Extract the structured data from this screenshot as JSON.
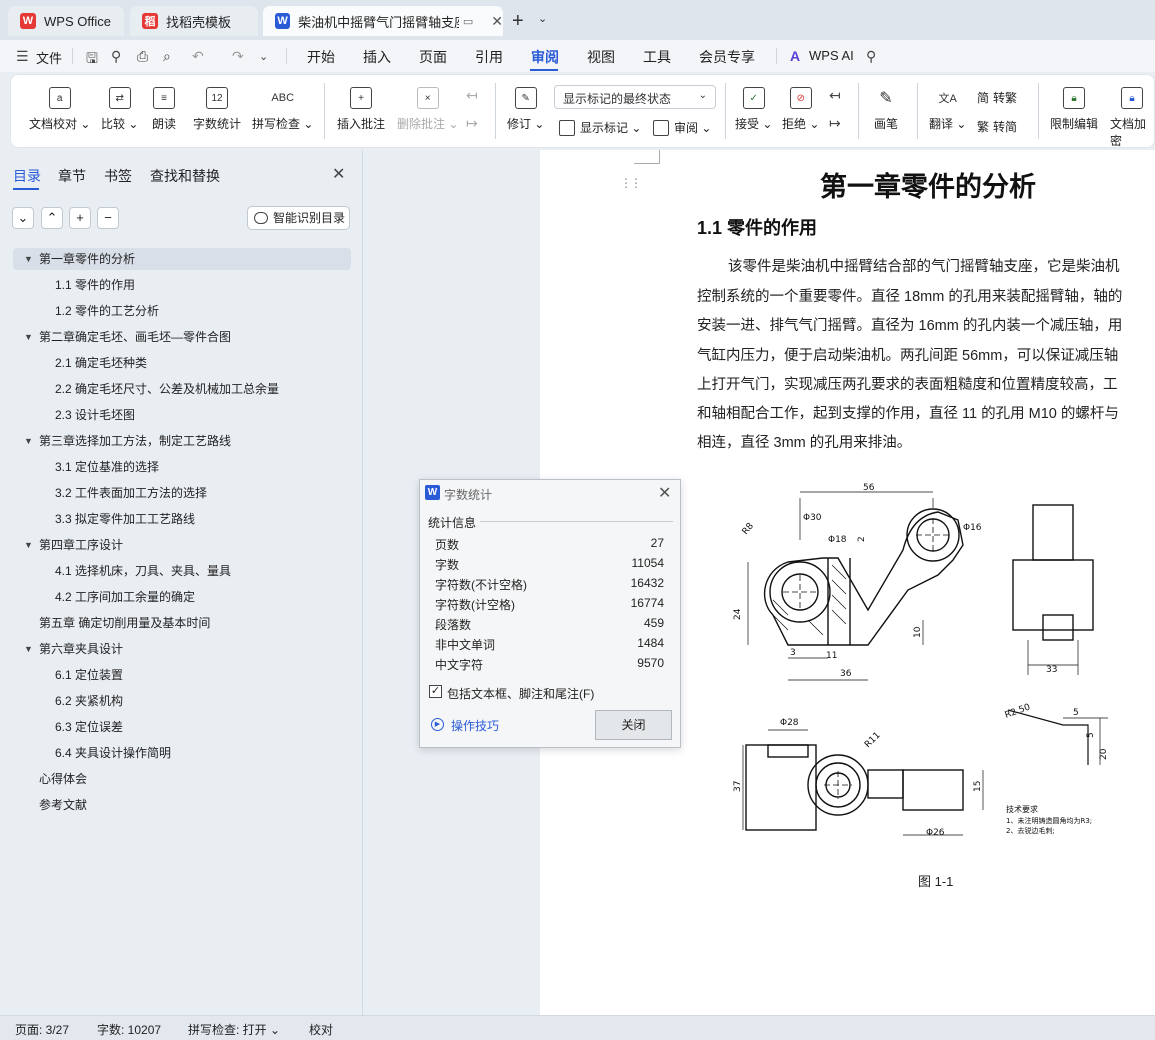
{
  "tabs": [
    {
      "label": "WPS Office"
    },
    {
      "label": "找稻壳模板"
    },
    {
      "label": "柴油机中摇臂气门摇臂轴支座"
    }
  ],
  "menu": {
    "file": "文件",
    "items": [
      "开始",
      "插入",
      "页面",
      "引用",
      "审阅",
      "视图",
      "工具",
      "会员专享"
    ],
    "ai": "WPS AI"
  },
  "ribbon": {
    "doc_proof": "文档校对",
    "compare": "比较",
    "read_aloud": "朗读",
    "word_count": "字数统计",
    "spell_check": "拼写检查",
    "insert_comment": "插入批注",
    "delete_comment": "删除批注",
    "revise": "修订",
    "markup_dropdown": "显示标记的最终状态",
    "show_markup": "显示标记",
    "review": "审阅",
    "accept": "接受",
    "reject": "拒绝",
    "pen": "画笔",
    "translate": "翻译",
    "to_traditional": "转繁",
    "to_simplified": "转简",
    "restrict_edit": "限制编辑",
    "doc_encrypt": "文档加密",
    "word_count_icon_text": "12",
    "spell_icon_text": "ABC"
  },
  "leftpane": {
    "tabs": [
      "目录",
      "章节",
      "书签",
      "查找和替换"
    ],
    "smart_toc": "智能识别目录",
    "toc": [
      {
        "label": "第一章零件的分析",
        "level": 1,
        "expanded": true,
        "selected": true
      },
      {
        "label": "1.1 零件的作用",
        "level": 2
      },
      {
        "label": "1.2 零件的工艺分析",
        "level": 2
      },
      {
        "label": "第二章确定毛坯、画毛坯—零件合图",
        "level": 1,
        "expanded": true
      },
      {
        "label": "2.1 确定毛坯种类",
        "level": 2
      },
      {
        "label": "2.2 确定毛坯尺寸、公差及机械加工总余量",
        "level": 2
      },
      {
        "label": "2.3 设计毛坯图",
        "level": 2
      },
      {
        "label": "第三章选择加工方法，制定工艺路线",
        "level": 1,
        "expanded": true
      },
      {
        "label": "3.1 定位基准的选择",
        "level": 2
      },
      {
        "label": "3.2 工件表面加工方法的选择",
        "level": 2
      },
      {
        "label": "3.3 拟定零件加工工艺路线",
        "level": 2
      },
      {
        "label": "第四章工序设计",
        "level": 1,
        "expanded": true
      },
      {
        "label": "4.1 选择机床，刀具、夹具、量具",
        "level": 2
      },
      {
        "label": "4.2 工序间加工余量的确定",
        "level": 2
      },
      {
        "label": "第五章   确定切削用量及基本时间",
        "level": 1
      },
      {
        "label": "第六章夹具设计",
        "level": 1,
        "expanded": true
      },
      {
        "label": "6.1 定位装置",
        "level": 2
      },
      {
        "label": "6.2 夹紧机构",
        "level": 2
      },
      {
        "label": "6.3 定位误差",
        "level": 2
      },
      {
        "label": "6.4 夹具设计操作简明",
        "level": 2
      },
      {
        "label": "心得体会",
        "level": 1
      },
      {
        "label": "参考文献",
        "level": 1
      }
    ]
  },
  "document": {
    "heading": "第一章零件的分析",
    "subheading": "1.1 零件的作用",
    "lines": [
      "该零件是柴油机中摇臂结合部的气门摇臂轴支座，它是柴油机",
      "控制系统的一个重要零件。直径 18mm 的孔用来装配摇臂轴，轴的",
      "安装一进、排气气门摇臂。直径为 16mm 的孔内装一个减压轴，用",
      "气缸内压力，便于启动柴油机。两孔间距 56mm，可以保证减压轴",
      "上打开气门，实现减压两孔要求的表面粗糙度和位置精度较高，工",
      "和轴相配合工作，起到支撑的作用，直径 11 的孔用 M10 的螺杆与",
      "相连，直径 3mm 的孔用来排油。"
    ],
    "figure_caption": "图 1-1",
    "drawing": {
      "dims": [
        "56",
        "Φ30",
        "Φ16",
        "R8",
        "Φ18",
        "24",
        "10",
        "36",
        "3",
        "11",
        "2",
        "Φ28",
        "R11",
        "37",
        "15",
        "Φ26",
        "R2.50",
        "5",
        "5",
        "20",
        "33"
      ],
      "tech_title": "技术要求",
      "tech_1": "1、未注明铸造圆角均为R3;",
      "tech_2": "2、去锐边毛刺;"
    }
  },
  "dialog": {
    "title": "字数统计",
    "section": "统计信息",
    "stats": [
      {
        "label": "页数",
        "value": "27"
      },
      {
        "label": "字数",
        "value": "11054"
      },
      {
        "label": "字符数(不计空格)",
        "value": "16432"
      },
      {
        "label": "字符数(计空格)",
        "value": "16774"
      },
      {
        "label": "段落数",
        "value": "459"
      },
      {
        "label": "非中文单词",
        "value": "1484"
      },
      {
        "label": "中文字符",
        "value": "9570"
      }
    ],
    "include_label": "包括文本框、脚注和尾注(F)",
    "include_checked": true,
    "tips": "操作技巧",
    "close": "关闭"
  },
  "status": {
    "page": "页面: 3/27",
    "words": "字数: 10207",
    "spell": "拼写检查: 打开",
    "proof": "校对"
  },
  "colors": {
    "accent": "#2a5bd7",
    "wps_red": "#e53935",
    "page": "#ffffff"
  }
}
